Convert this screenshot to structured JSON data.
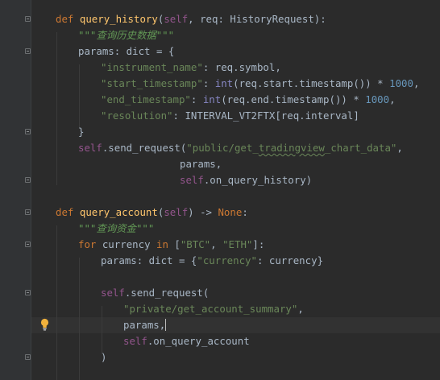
{
  "code": {
    "query_history": {
      "kw_def": "def",
      "name": "query_history",
      "signature_open": "(",
      "self_kw": "self",
      "params_sig": ", req: HistoryRequest):",
      "docstring": "\"\"\"查询历史数据\"\"\"",
      "params_decl": "params: dict = {",
      "key_instrument": "\"instrument_name\"",
      "val_instrument": ": req.symbol,",
      "key_start": "\"start_timestamp\"",
      "start_mid": ": ",
      "int_builtin": "int",
      "start_expr": "(req.start.timestamp()) * ",
      "num_1000": "1000",
      "comma": ",",
      "key_end": "\"end_timestamp\"",
      "end_expr": "(req.end.timestamp()) * ",
      "key_resolution": "\"resolution\"",
      "val_resolution": ": INTERVAL_VT2FTX[req.interval]",
      "close_brace": "}",
      "self_call": "self",
      "send_request": ".send_request(",
      "str_prefix": "\"public/get_",
      "str_wavy": "tradingview",
      "str_suffix": "_chart_data\"",
      "arg_params": "params,",
      "self_cb": "self",
      "callback": ".on_query_history)"
    },
    "query_account": {
      "kw_def": "def",
      "name": "query_account",
      "signature_open": "(",
      "self_kw": "self",
      "arrow": ") -> ",
      "none_kw": "None",
      "colon": ":",
      "docstring": "\"\"\"查询资金\"\"\"",
      "for_kw": "for",
      "currency_var": " currency ",
      "in_kw": "in",
      "list_open": " [",
      "btc": "\"BTC\"",
      "list_sep": ", ",
      "eth": "\"ETH\"",
      "list_close": "]:",
      "params_assign": "params: dict = {",
      "key_currency": "\"currency\"",
      "currency_val": ": currency}",
      "self_call": "self",
      "send_request": ".send_request(",
      "endpoint": "\"private/get_account_summary\"",
      "comma": ",",
      "arg_params": "params,",
      "self_cb": "self",
      "callback": ".on_query_account",
      "close_paren": ")"
    }
  },
  "icons": {
    "fold_marker": "fold-icon",
    "intention_bulb": "lightbulb-icon"
  },
  "colors": {
    "background": "#2b2b2b",
    "keyword": "#cc7832",
    "function": "#ffc66d",
    "self": "#94558d",
    "string": "#6a8759",
    "number": "#6897bb",
    "builtin": "#8888c6",
    "bulb": "#f0b13c"
  }
}
